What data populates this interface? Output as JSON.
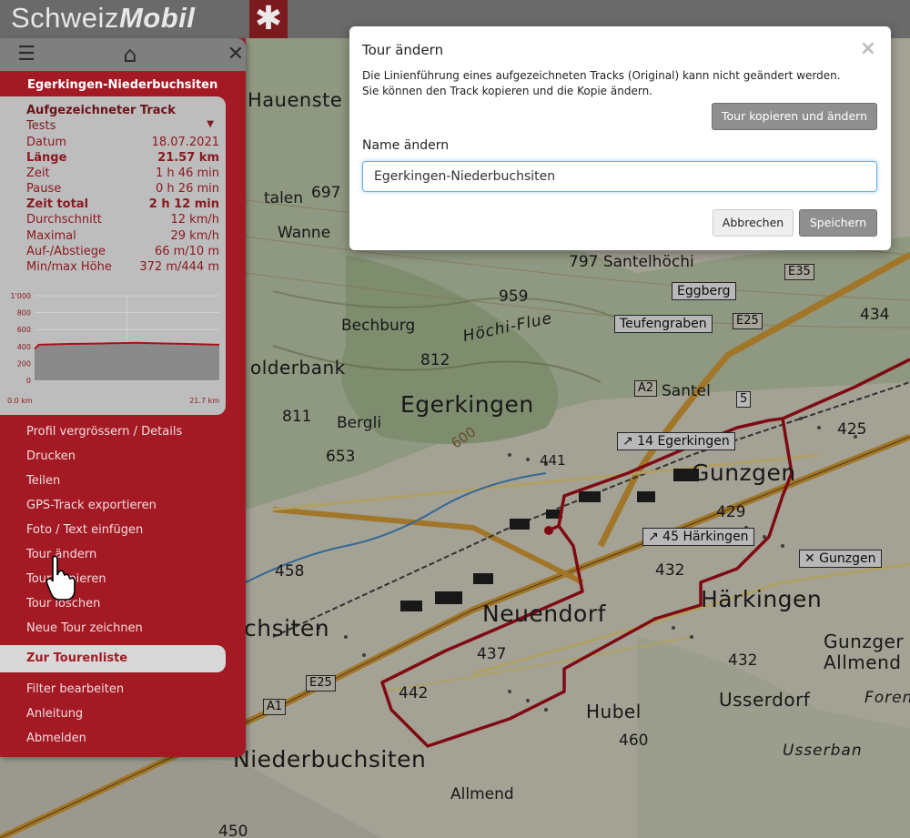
{
  "header": {
    "logo_light": "Schweiz",
    "logo_bold": "Mobil",
    "logo_cross": "✱"
  },
  "topbar": {
    "menu_icon": "☰",
    "home_icon": "⌂",
    "close_icon": "✕"
  },
  "sidebar": {
    "track_title": "Egerkingen-Niederbuchsiten",
    "info_heading": "Aufgezeichneter Track",
    "category": "Tests",
    "stats": [
      {
        "k": "Datum",
        "v": "18.07.2021",
        "bold": false
      },
      {
        "k": "Länge",
        "v": "21.57 km",
        "bold": true
      },
      {
        "k": "Zeit",
        "v": "1 h 46 min",
        "bold": false
      },
      {
        "k": "Pause",
        "v": "0 h 26 min",
        "bold": false
      },
      {
        "k": "Zeit total",
        "v": "2 h 12 min",
        "bold": true
      },
      {
        "k": "Durchschnitt",
        "v": "12 km/h",
        "bold": false
      },
      {
        "k": "Maximal",
        "v": "29 km/h",
        "bold": false
      },
      {
        "k": "Auf-/Abstiege",
        "v": "66 m/10 m",
        "bold": false
      },
      {
        "k": "Min/max Höhe",
        "v": "372 m/444 m",
        "bold": false
      }
    ],
    "menu": [
      "Profil vergrössern / Details",
      "Drucken",
      "Teilen",
      "GPS-Track exportieren",
      "Foto / Text einfügen",
      "Tour ändern",
      "Tour kopieren",
      "Tour löschen",
      "Neue Tour zeichnen"
    ],
    "tourlist_button": "Zur Tourenliste",
    "menu2": [
      "Filter bearbeiten",
      "Anleitung",
      "Abmelden"
    ]
  },
  "chart_data": {
    "type": "area",
    "x_tick_labels": [
      "0.0 km",
      "21.7 km"
    ],
    "y_tick_labels": [
      "1'000",
      "800",
      "600",
      "400",
      "200",
      "0"
    ],
    "ylim": [
      0,
      1000
    ],
    "xlim": [
      0,
      21.7
    ],
    "x": [
      0,
      0.5,
      2,
      4,
      6,
      8,
      10,
      12,
      14,
      16,
      18,
      20,
      21.7
    ],
    "values": [
      372,
      420,
      425,
      430,
      432,
      435,
      440,
      444,
      438,
      434,
      430,
      425,
      420
    ],
    "grid": true
  },
  "modal": {
    "title": "Tour ändern",
    "close": "×",
    "line1": "Die Linienführung eines aufgezeichneten Tracks (Original) kann nicht geändert werden.",
    "line2": "Sie können den Track kopieren und die Kopie ändern.",
    "copy_button": "Tour kopieren und ändern",
    "name_label": "Name ändern",
    "name_value": "Egerkingen-Niederbuchsiten",
    "cancel_button": "Abbrechen",
    "save_button": "Speichern"
  },
  "map": {
    "labels": {
      "egerkingen": "Egerkingen",
      "gunzgen": "Gunzgen",
      "neuendorf": "Neuendorf",
      "haerkingen": "Härkingen",
      "niederbuchsiten": "Niederbuchsiten",
      "chsiten": "chsiten",
      "bechburg": "Bechburg",
      "olderbank": "olderbank",
      "bergli": "Bergli",
      "santel": "Santel",
      "santelhoechi": "797 Santelhöchi",
      "hoechiflue": "Höchi-Flue",
      "teufengraben": "Teufengraben",
      "eggberg": "Eggberg",
      "usserdorf": "Usserdorf",
      "gunzgerallmend1": "Gunzger",
      "gunzgerallmend2": "Allmend",
      "hubel": "Hubel",
      "allmend": "Allmend",
      "usserban": "Usserban",
      "forenba": "Forenba",
      "wanne": "Wanne",
      "talen": "talen",
      "hauensteg": "Hauenste",
      "e35": "E35",
      "e25a": "E25",
      "e25b": "E25",
      "a2": "A2",
      "a1": "A1",
      "r5": "5",
      "sign14": "↗ 14 Egerkingen",
      "sign45": "↗ 45 Härkingen",
      "gunzgen_rest": "✕ Gunzgen",
      "h959": "959",
      "h812": "812",
      "h811": "811",
      "h653": "653",
      "h697": "697",
      "h441": "441",
      "h425": "425",
      "h429": "429",
      "h432a": "432",
      "h432b": "432",
      "h437": "437",
      "h442": "442",
      "h458": "458",
      "h460": "460",
      "h450": "450",
      "h434": "434",
      "h600": "600"
    }
  }
}
